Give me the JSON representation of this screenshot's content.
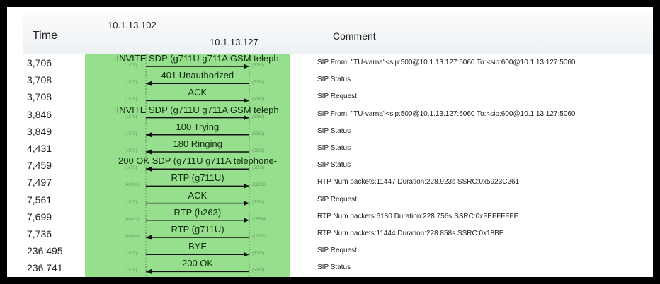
{
  "headers": {
    "time": "Time",
    "ip_left": "10.1.13.102",
    "ip_right": "10.1.13.127",
    "comment": "Comment"
  },
  "rows": [
    {
      "time": "3,706",
      "label": "INVITE SDP (g711U g711A GSM teleph",
      "dir": "right",
      "lport": "(1878)",
      "rport": "(5060)",
      "comment": "SIP From: \"TU-varna\"<sip:500@10.1.13.127:5060 To:<sip:600@10.1.13.127:5060"
    },
    {
      "time": "3,708",
      "label": "401 Unauthorized",
      "dir": "left",
      "lport": "(1878)",
      "rport": "(5060)",
      "comment": "SIP Status"
    },
    {
      "time": "3,708",
      "label": "ACK",
      "dir": "right",
      "lport": "(1878)",
      "rport": "(5060)",
      "comment": "SIP Request"
    },
    {
      "time": "3,846",
      "label": "INVITE SDP (g711U g711A GSM teleph",
      "dir": "right",
      "lport": "(1878)",
      "rport": "(5060)",
      "comment": "SIP From: \"TU-varna\"<sip:500@10.1.13.127:5060 To:<sip:600@10.1.13.127:5060"
    },
    {
      "time": "3,849",
      "label": "100 Trying",
      "dir": "left",
      "lport": "(1878)",
      "rport": "(5060)",
      "comment": "SIP Status"
    },
    {
      "time": "4,431",
      "label": "180 Ringing",
      "dir": "left",
      "lport": "(1878)",
      "rport": "(5060)",
      "comment": "SIP Status"
    },
    {
      "time": "7,459",
      "label": "200 OK SDP (g711U g711A telephone-",
      "dir": "left",
      "lport": "(1878)",
      "rport": "(5060)",
      "comment": "SIP Status"
    },
    {
      "time": "7,497",
      "label": "RTP (g711U)",
      "dir": "right",
      "lport": "(40014)",
      "rport": "(12260)",
      "comment": "RTP Num packets:11447  Duration:228.923s SSRC:0x5923C261"
    },
    {
      "time": "7,561",
      "label": "ACK",
      "dir": "right",
      "lport": "(1878)",
      "rport": "(5060)",
      "comment": "SIP Request"
    },
    {
      "time": "7,699",
      "label": "RTP (h263)",
      "dir": "right",
      "lport": "(40012)",
      "rport": "(18534)",
      "comment": "RTP Num packets:6180  Duration:228.756s SSRC:0xFEFFFFFF"
    },
    {
      "time": "7,736",
      "label": "RTP (g711U)",
      "dir": "left",
      "lport": "(40014)",
      "rport": "(12260)",
      "comment": "RTP Num packets:11444  Duration:228.858s SSRC:0x18BE"
    },
    {
      "time": "236,495",
      "label": "BYE",
      "dir": "right",
      "lport": "(1878)",
      "rport": "(5060)",
      "comment": "SIP Request"
    },
    {
      "time": "236,741",
      "label": "200 OK",
      "dir": "left",
      "lport": "(1878)",
      "rport": "(5060)",
      "comment": "SIP Status"
    }
  ],
  "colors": {
    "flow_bg": "#96df8c",
    "arrow": "#111111",
    "lifeline": "#5a8a5a"
  }
}
